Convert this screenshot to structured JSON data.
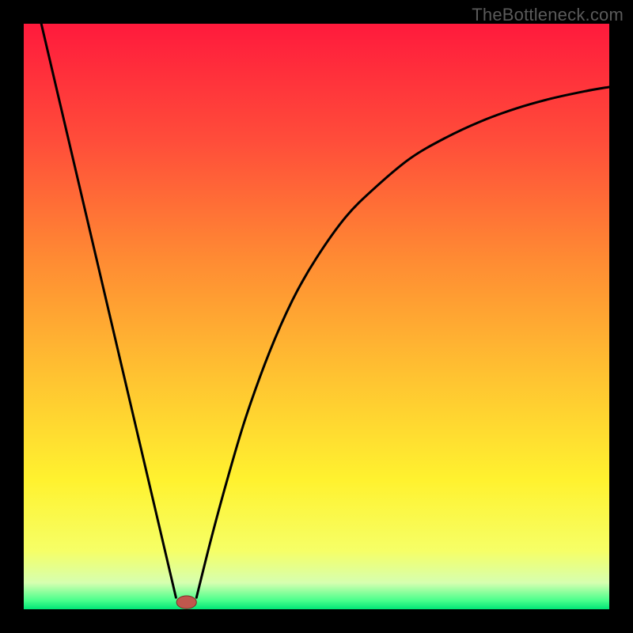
{
  "watermark": "TheBottleneck.com",
  "colors": {
    "frame": "#000000",
    "curve": "#000000",
    "marker_fill": "#c0574d",
    "gradient_stops": [
      {
        "offset": 0.0,
        "color": "#ff1a3c"
      },
      {
        "offset": 0.2,
        "color": "#ff4d3a"
      },
      {
        "offset": 0.4,
        "color": "#ff8a33"
      },
      {
        "offset": 0.6,
        "color": "#ffc231"
      },
      {
        "offset": 0.78,
        "color": "#fff22f"
      },
      {
        "offset": 0.9,
        "color": "#f6ff66"
      },
      {
        "offset": 0.955,
        "color": "#d6ffb0"
      },
      {
        "offset": 0.985,
        "color": "#49ff8c"
      },
      {
        "offset": 1.0,
        "color": "#00e676"
      }
    ]
  },
  "chart_data": {
    "type": "line",
    "title": "",
    "xlabel": "",
    "ylabel": "",
    "xlim": [
      0,
      100
    ],
    "ylim": [
      0,
      100
    ],
    "grid": false,
    "series": [
      {
        "name": "left-branch",
        "x": [
          3,
          26
        ],
        "y": [
          100,
          2
        ]
      },
      {
        "name": "right-branch",
        "x": [
          29.5,
          32,
          35,
          38,
          42,
          46,
          50,
          55,
          60,
          66,
          72,
          78,
          84,
          90,
          96,
          100
        ],
        "y": [
          2,
          12,
          23,
          33,
          44,
          53,
          60,
          67,
          72,
          77,
          80.5,
          83.3,
          85.5,
          87.2,
          88.5,
          89.2
        ]
      }
    ],
    "marker": {
      "x": 27.8,
      "y": 1.2,
      "rx": 1.7,
      "ry": 1.1
    },
    "legend": null
  }
}
